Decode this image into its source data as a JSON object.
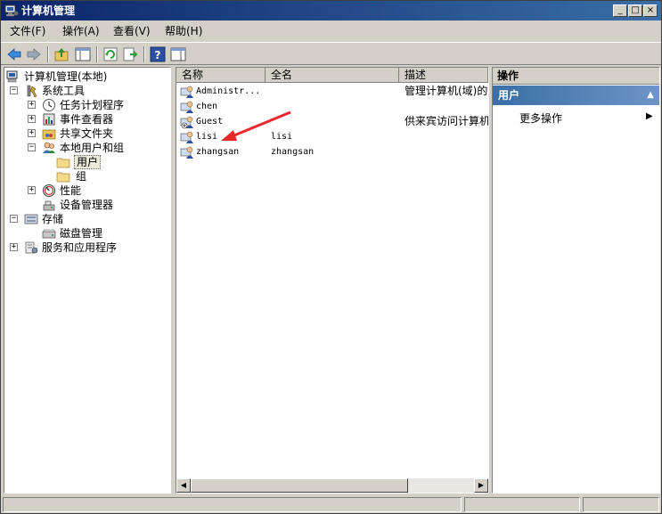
{
  "window": {
    "title": "计算机管理"
  },
  "window_controls": {
    "minimize": "_",
    "maximize": "□",
    "close": "×"
  },
  "menubar": {
    "items": [
      {
        "label": "文件(F)"
      },
      {
        "label": "操作(A)"
      },
      {
        "label": "查看(V)"
      },
      {
        "label": "帮助(H)"
      }
    ]
  },
  "toolbar": {
    "buttons": [
      "back-icon",
      "forward-icon",
      "up-folder-icon",
      "show-hide-tree-icon",
      "refresh-icon",
      "export-list-icon",
      "help-icon",
      "action-pane-icon"
    ]
  },
  "tree": {
    "items": [
      {
        "label": "计算机管理(本地)",
        "icon": "computer-management-icon"
      },
      {
        "label": "系统工具",
        "icon": "system-tools-icon",
        "expander": "−"
      },
      {
        "label": "任务计划程序",
        "icon": "clock-icon",
        "expander": "+"
      },
      {
        "label": "事件查看器",
        "icon": "event-viewer-icon",
        "expander": "+"
      },
      {
        "label": "共享文件夹",
        "icon": "shared-folder-icon",
        "expander": "+"
      },
      {
        "label": "本地用户和组",
        "icon": "users-groups-icon",
        "expander": "−"
      },
      {
        "label": "用户",
        "icon": "folder-icon",
        "selected": true
      },
      {
        "label": "组",
        "icon": "folder-icon"
      },
      {
        "label": "性能",
        "icon": "performance-icon",
        "expander": "+"
      },
      {
        "label": "设备管理器",
        "icon": "device-manager-icon"
      },
      {
        "label": "存储",
        "icon": "storage-icon",
        "expander": "−"
      },
      {
        "label": "磁盘管理",
        "icon": "disk-icon"
      },
      {
        "label": "服务和应用程序",
        "icon": "services-icon",
        "expander": "+"
      }
    ]
  },
  "list": {
    "columns": [
      "名称",
      "全名",
      "描述"
    ],
    "rows": [
      {
        "name": "Administr...",
        "fullname": "",
        "description": "管理计算机(域)的"
      },
      {
        "name": "chen",
        "fullname": "",
        "description": ""
      },
      {
        "name": "Guest",
        "fullname": "",
        "description": "供来宾访问计算机"
      },
      {
        "name": "lisi",
        "fullname": "lisi",
        "description": ""
      },
      {
        "name": "zhangsan",
        "fullname": "zhangsan",
        "description": ""
      }
    ]
  },
  "actions": {
    "header": "操作",
    "selected_section": "用户",
    "collapse_glyph": "▲",
    "more_actions": "更多操作",
    "more_actions_arrow": "▶"
  },
  "annotation": {
    "color": "#e8282b"
  }
}
